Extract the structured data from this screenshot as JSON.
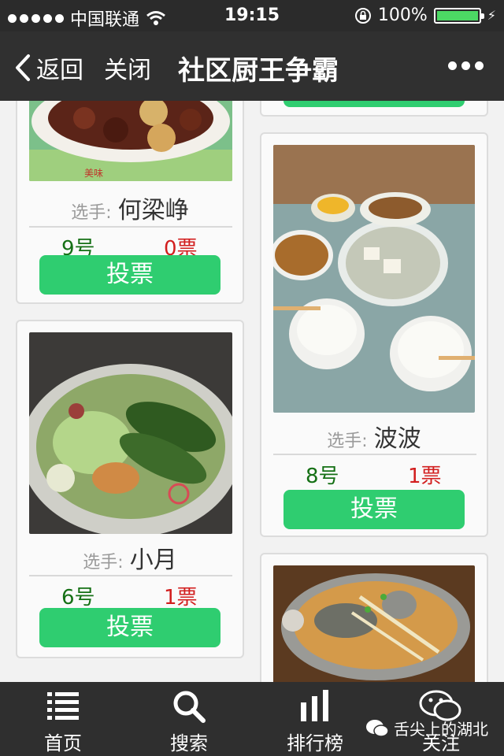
{
  "status_bar": {
    "carrier": "中国联通",
    "time": "19:15",
    "battery": "100%"
  },
  "navbar": {
    "back_label": "返回",
    "close_label": "关闭",
    "title": "社区厨王争霸",
    "more_icon": "more-icon"
  },
  "player_label": "选手:",
  "vote_button_label": "投票",
  "cards": [
    {
      "name": "何梁峥",
      "number": "9号",
      "votes": "0票"
    },
    {
      "name": "小月",
      "number": "6号",
      "votes": "1票"
    },
    {
      "name": "波波",
      "number": "8号",
      "votes": "1票"
    }
  ],
  "tabs": [
    {
      "label": "首页",
      "icon": "list-icon"
    },
    {
      "label": "搜索",
      "icon": "search-icon"
    },
    {
      "label": "排行榜",
      "icon": "bar-chart-icon"
    },
    {
      "label": "关注",
      "icon": "wechat-icon"
    }
  ],
  "watermark": "舌尖上的湖北",
  "colors": {
    "accent_green": "#2fcd70",
    "number_green": "#157015",
    "votes_red": "#d21e1e",
    "bar_dark": "#2f2f2f"
  }
}
